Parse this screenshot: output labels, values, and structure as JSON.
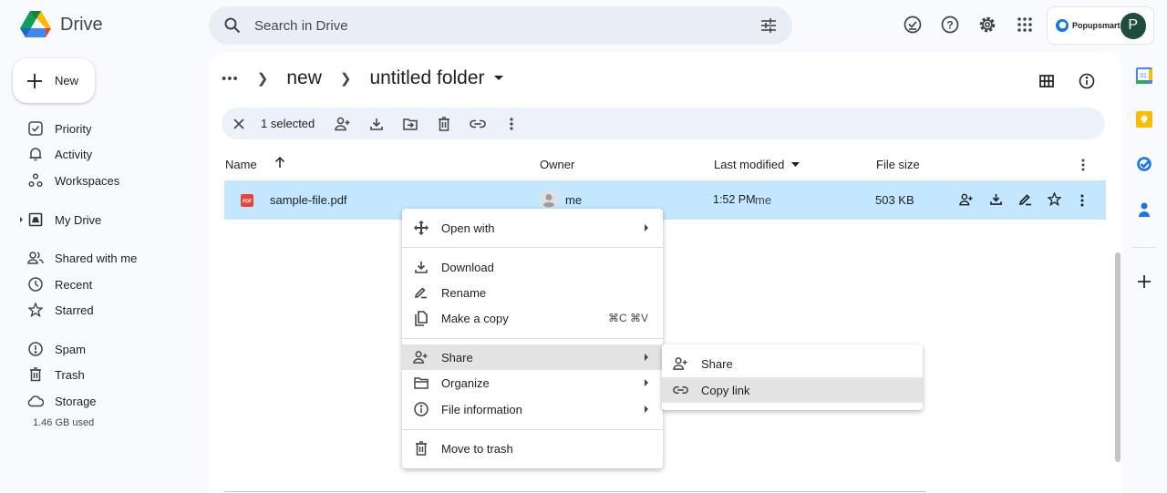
{
  "app": {
    "name": "Drive"
  },
  "search": {
    "placeholder": "Search in Drive"
  },
  "header_icons": [
    "ready-for-offline-icon",
    "help-icon",
    "settings-icon",
    "apps-icon"
  ],
  "account": {
    "org": "Popupsmart",
    "avatar_letter": "P",
    "avatar_color": "#1e4d3b"
  },
  "sidebar": {
    "new_label": "New",
    "items": [
      {
        "label": "Priority",
        "icon": "priority-icon"
      },
      {
        "label": "Activity",
        "icon": "bell-icon"
      },
      {
        "label": "Workspaces",
        "icon": "workspaces-icon"
      },
      {
        "label": "My Drive",
        "icon": "my-drive-icon"
      },
      {
        "label": "Shared with me",
        "icon": "shared-icon"
      },
      {
        "label": "Recent",
        "icon": "clock-icon"
      },
      {
        "label": "Starred",
        "icon": "star-icon"
      },
      {
        "label": "Spam",
        "icon": "spam-icon"
      },
      {
        "label": "Trash",
        "icon": "trash-icon"
      },
      {
        "label": "Storage",
        "icon": "cloud-icon"
      }
    ],
    "storage_used": "1.46 GB used"
  },
  "breadcrumb": {
    "items": [
      "new",
      "untitled folder"
    ]
  },
  "selection": {
    "count_label": "1 selected"
  },
  "table": {
    "columns": {
      "name": "Name",
      "owner": "Owner",
      "modified": "Last modified",
      "size": "File size"
    },
    "rows": [
      {
        "name": "sample-file.pdf",
        "type_badge": "PDF",
        "owner": "me",
        "modified_time": "1:52 PM",
        "modified_by": "me",
        "size": "503 KB"
      }
    ]
  },
  "context_menu": {
    "items": [
      {
        "label": "Open with",
        "icon": "open-with-icon",
        "submenu": true
      },
      {
        "label": "Download",
        "icon": "download-icon"
      },
      {
        "label": "Rename",
        "icon": "rename-icon"
      },
      {
        "label": "Make a copy",
        "icon": "copy-icon",
        "shortcut": "⌘C ⌘V"
      },
      {
        "label": "Share",
        "icon": "share-icon",
        "submenu": true,
        "highlighted": true
      },
      {
        "label": "Organize",
        "icon": "folder-icon",
        "submenu": true
      },
      {
        "label": "File information",
        "icon": "info-icon",
        "submenu": true
      },
      {
        "label": "Move to trash",
        "icon": "trash-icon"
      }
    ]
  },
  "share_submenu": {
    "items": [
      {
        "label": "Share",
        "icon": "share-icon"
      },
      {
        "label": "Copy link",
        "icon": "link-icon",
        "highlighted": true
      }
    ]
  },
  "colors": {
    "accent": "#0b57d0",
    "selected_row": "#c2e7ff",
    "pdf_red": "#ea4335"
  }
}
